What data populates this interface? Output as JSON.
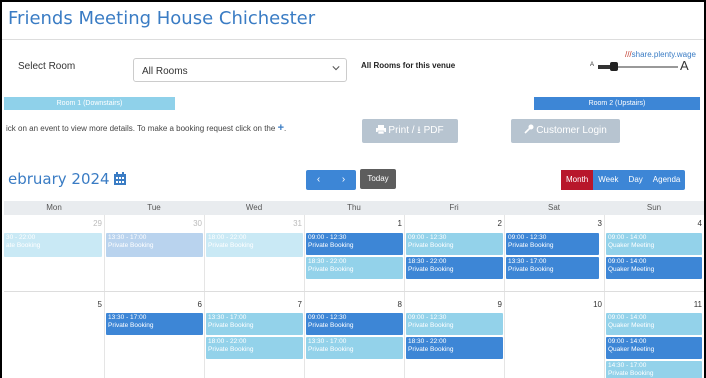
{
  "header": {
    "venue_title": "Friends Meeting House Chichester"
  },
  "controls": {
    "select_room_label": "Select Room",
    "room_select_value": "All Rooms",
    "all_rooms_text": "All Rooms for this venue",
    "share_slashes": "///",
    "share_link": "share.plenty.wage",
    "font_small": "A",
    "font_large": "A",
    "font_size_level": 0.2
  },
  "rooms": {
    "room1": "Room 1 (Downstairs)",
    "room2": "Room 2 (Upstairs)"
  },
  "info": {
    "text": "ick on an event to view more details. To make a booking request click on the",
    "plus": "+",
    "period": "."
  },
  "buttons": {
    "print_pdf": "Print / ⭳ PDF",
    "customer_login": "Customer Login"
  },
  "calendar": {
    "month_title": "ebruary 2024",
    "prev": "‹",
    "next": "›",
    "today": "Today",
    "views": [
      "Month",
      "Week",
      "Day",
      "Agenda"
    ],
    "active_view": "Month",
    "day_names": [
      "Mon",
      "Tue",
      "Wed",
      "Thu",
      "Fri",
      "Sat",
      "Sun"
    ],
    "week1_dates": [
      "29",
      "30",
      "31",
      "1",
      "2",
      "3",
      "4"
    ],
    "week2_dates": [
      "5",
      "6",
      "7",
      "8",
      "9",
      "10",
      "11"
    ],
    "events_week1": {
      "mon": [
        {
          "time": "30 - 22:00",
          "title": "ate Booking"
        }
      ],
      "tue": [
        {
          "time": "13:30 - 17:00",
          "title": "Private Booking"
        }
      ],
      "wed": [
        {
          "time": "18:00 - 22:00",
          "title": "Private Booking"
        }
      ],
      "thu": [
        {
          "time": "09:00 - 12:30",
          "title": "Private Booking"
        },
        {
          "time": "18:30 - 22:00",
          "title": "Private Booking"
        }
      ],
      "fri": [
        {
          "time": "09:00 - 12:30",
          "title": "Private Booking"
        },
        {
          "time": "18:30 - 22:00",
          "title": "Private Booking"
        }
      ],
      "sat": [
        {
          "time": "09:00 - 12:30",
          "title": "Private Booking"
        },
        {
          "time": "13:30 - 17:00",
          "title": "Private Booking"
        }
      ],
      "sun": [
        {
          "time": "09:00 - 14:00",
          "title": "Quaker Meeting"
        },
        {
          "time": "09:00 - 14:00",
          "title": "Quaker Meeting"
        }
      ]
    },
    "events_week2": {
      "tue": [
        {
          "time": "13:30 - 17:00",
          "title": "Private Booking"
        }
      ],
      "wed": [
        {
          "time": "13:30 - 17:00",
          "title": "Private Booking"
        },
        {
          "time": "18:00 - 22:00",
          "title": "Private Booking"
        }
      ],
      "thu": [
        {
          "time": "09:00 - 12:30",
          "title": "Private Booking"
        },
        {
          "time": "13:30 - 17:00",
          "title": "Private Booking"
        }
      ],
      "fri": [
        {
          "time": "09:00 - 12:30",
          "title": "Private Booking"
        },
        {
          "time": "18:30 - 22:00",
          "title": "Private Booking"
        }
      ],
      "sun": [
        {
          "time": "09:00 - 14:00",
          "title": "Quaker Meeting"
        },
        {
          "time": "09:00 - 14:00",
          "title": "Quaker Meeting"
        },
        {
          "time": "14:30 - 17:00",
          "title": "Private Booking"
        }
      ]
    }
  }
}
